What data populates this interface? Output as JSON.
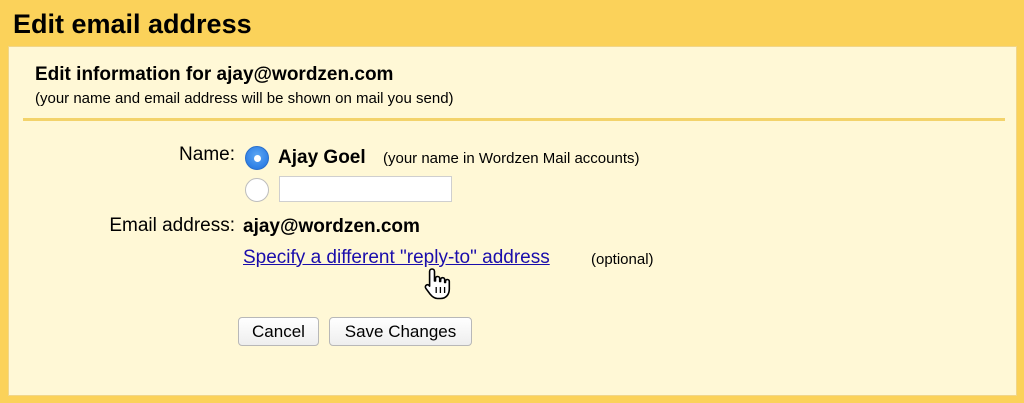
{
  "dialog": {
    "title": "Edit email address"
  },
  "header": {
    "title": "Edit information for ajay@wordzen.com",
    "subtitle": "(your name and email address will be shown on mail you send)"
  },
  "form": {
    "name_label": "Name:",
    "name_options": [
      {
        "label": "Ajay Goel",
        "hint": "(your name in Wordzen Mail accounts)",
        "selected": true
      },
      {
        "input_value": "",
        "placeholder": "",
        "selected": false
      }
    ],
    "email_label": "Email address:",
    "email_value": "ajay@wordzen.com",
    "reply_to_link": "Specify a different \"reply-to\" address",
    "reply_to_hint": "(optional)"
  },
  "buttons": {
    "cancel": "Cancel",
    "save": "Save Changes"
  },
  "colors": {
    "accent_yellow": "#fbd25a",
    "panel_background": "#fff8d6",
    "link_blue": "#1a0dab",
    "radio_blue": "#2f80e6"
  },
  "icons": {
    "cursor": "hand-pointer-icon"
  }
}
